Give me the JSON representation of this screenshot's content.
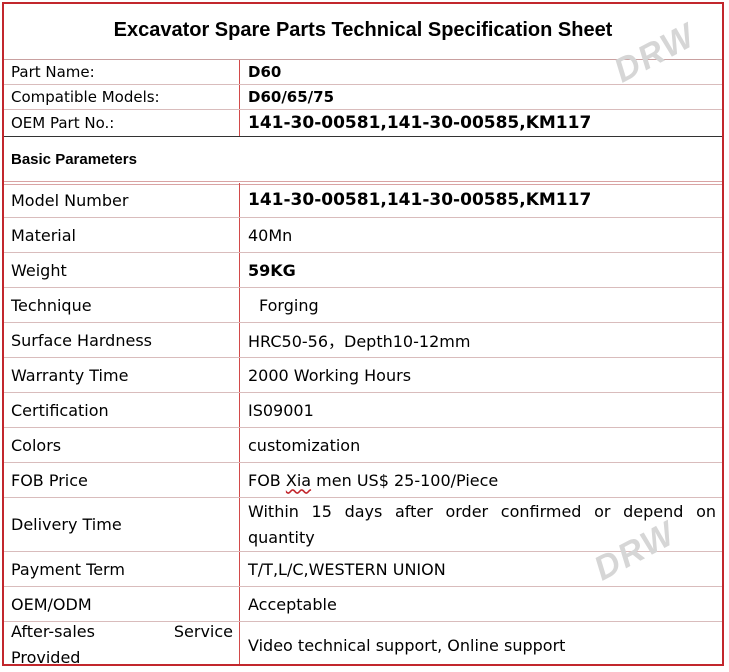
{
  "title": "Excavator Spare Parts Technical Specification Sheet",
  "header_rows": [
    {
      "label": "Part Name:",
      "value": "D60"
    },
    {
      "label": "Compatible Models:",
      "value": "D60/65/75"
    },
    {
      "label": "OEM Part No.:",
      "value": "141-30-00581,141-30-00585,KM117"
    }
  ],
  "section_title": "Basic Parameters",
  "params": [
    {
      "label": "Model Number",
      "value": "141-30-00581,141-30-00585,KM117"
    },
    {
      "label": "Material",
      "value": "40Mn"
    },
    {
      "label": "Weight",
      "value": "59KG"
    },
    {
      "label": "Technique",
      "value": "Forging"
    },
    {
      "label": "Surface Hardness",
      "value": "HRC50-56，Depth10-12mm"
    },
    {
      "label": "Warranty Time",
      "value": "2000 Working Hours"
    },
    {
      "label": "Certification",
      "value": "IS09001"
    },
    {
      "label": "Colors",
      "value": "customization"
    },
    {
      "label": "FOB Price",
      "value_pre": "FOB ",
      "value_squiggle": "Xia",
      "value_post": " men US$ 25-100/Piece"
    },
    {
      "label": "Delivery Time",
      "value": "Within 15 days after order confirmed or depend on quantity"
    },
    {
      "label": "Payment Term",
      "value": "T/T,L/C,WESTERN UNION"
    },
    {
      "label": "OEM/ODM",
      "value": "Acceptable"
    },
    {
      "label": "After-sales Service Provided",
      "value": "Video technical support, Online support"
    }
  ],
  "watermark": "DRW"
}
